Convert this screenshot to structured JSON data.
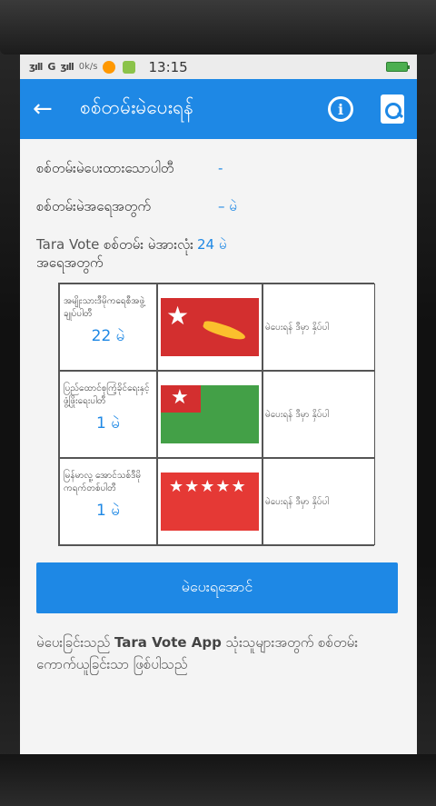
{
  "status": {
    "signal1": "ʒıll",
    "carrier": "G",
    "signal2": "ʒıll",
    "speed": "0k/s",
    "time": "13:15"
  },
  "appbar": {
    "title": "စစ်တမ်းမဲပေးရန်",
    "back_icon": "←",
    "info_icon": "i"
  },
  "summary": {
    "voted_time_label": "စစ်တမ်းမဲပေးထားသောပါတီ",
    "voted_time_value": "-",
    "count_label": "စစ်တမ်းမဲအရေအတွက်",
    "count_value": "– မဲ",
    "tally_brand": "Tara Vote",
    "tally_label": " စစ်တမ်း မဲအားလုံး",
    "tally_label2": "အရေအတွက်",
    "tally_value": "24 မဲ"
  },
  "parties": [
    {
      "name": "အမျိုးသားဒီမိုကရေစီအဖွဲ့ ချုပ်ပါတီ",
      "votes": "22 မဲ",
      "action": "မဲပေးရန် ဒီမှာ နှိပ်ပါ",
      "flag": "nld"
    },
    {
      "name": "ပြည်ထောင်စုကြံ့ခိုင်ရေးနှင့် ဖွံ့ဖြိုးရေးပါတီ",
      "votes": "1 မဲ",
      "action": "မဲပေးရန် ဒီမှာ နှိပ်ပါ",
      "flag": "usdp"
    },
    {
      "name": "မြန်မာလူ့ အောင်သစ်ဒီမိုကရက်တစ်ပါတီ",
      "votes": "1 မဲ",
      "action": "မဲပေးရန် ဒီမှာ နှိပ်ပါ",
      "flag": "fdp"
    }
  ],
  "vote_button": "မဲပေးရအောင်",
  "disclaimer": {
    "pre": "မဲပေးခြင်းသည် ",
    "app": "Tara Vote App",
    "post": " သုံးသူများအတွက် စစ်တမ်းကောက်ယူခြင်းသာ ဖြစ်ပါသည်"
  },
  "colors": {
    "primary": "#1e88e5",
    "red": "#d32f2f",
    "green": "#43a047",
    "gold": "#fbc02d"
  }
}
